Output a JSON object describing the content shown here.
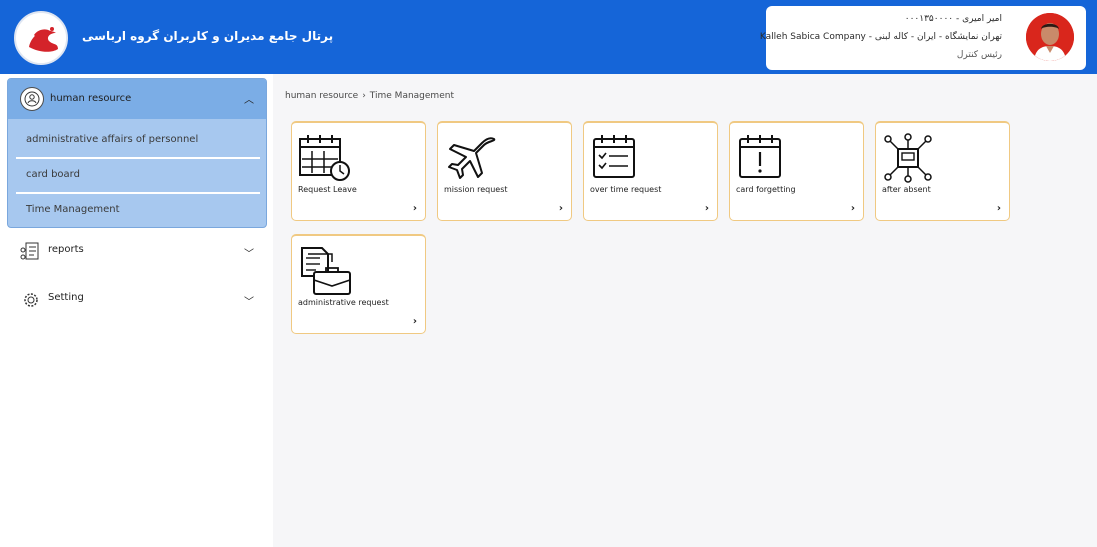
{
  "header": {
    "title": "پرتال جامع مدیران و کاربران گروه ارباسی",
    "profile": {
      "name_line": "امیر امیری - ۰۰۰۱۳۵۰۰۰۰",
      "company_line": "تهران نمایشگاه - ایران - کاله لبنی - Kalleh Sabica Company",
      "role_line": "رئیس کنترل"
    }
  },
  "sidebar": {
    "human_resource": {
      "label": "human resource",
      "items": [
        {
          "label": "administrative affairs of personnel"
        },
        {
          "label": "card board"
        },
        {
          "label": "Time Management"
        }
      ]
    },
    "menus": [
      {
        "label": "reports"
      },
      {
        "label": "Setting"
      }
    ]
  },
  "breadcrumb": {
    "root": "human resource",
    "separator": "›",
    "current": "Time Management"
  },
  "cards": [
    {
      "label": "Request Leave",
      "icon": "calendar-clock-icon"
    },
    {
      "label": "mission request",
      "icon": "airplane-icon"
    },
    {
      "label": "over time request",
      "icon": "calendar-checklist-icon"
    },
    {
      "label": "card forgetting",
      "icon": "calendar-alert-icon"
    },
    {
      "label": "after absent",
      "icon": "device-network-icon"
    },
    {
      "label": "administrative request",
      "icon": "documents-briefcase-icon"
    }
  ],
  "colors": {
    "header": "#1565d8",
    "card_border": "#f0c982",
    "sidebar_active": "#a7c8ef"
  }
}
